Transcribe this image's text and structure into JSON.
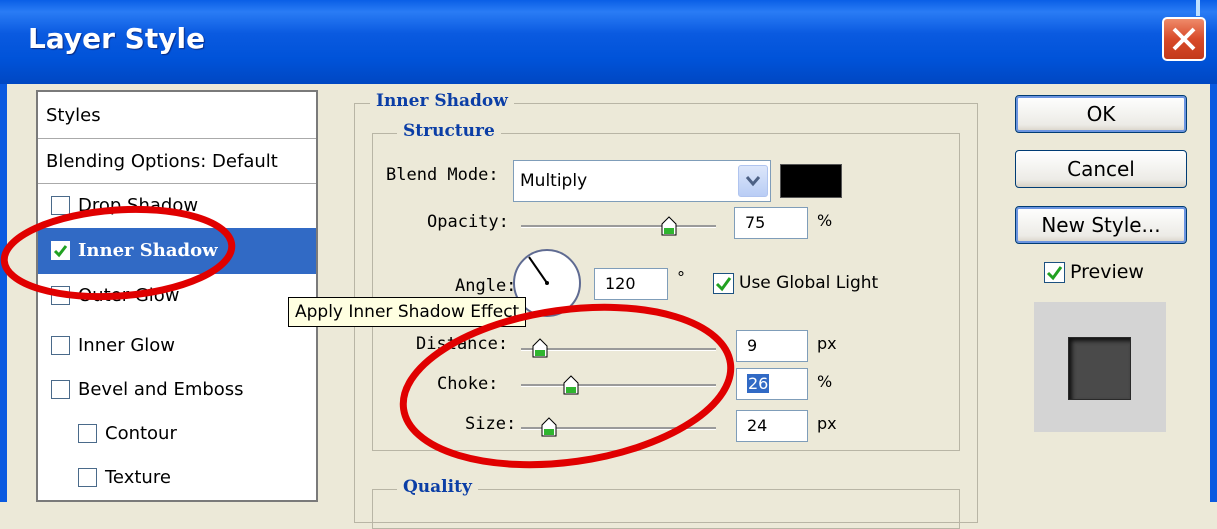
{
  "window": {
    "title": "Layer Style"
  },
  "styles_panel": {
    "header": "Styles",
    "blending": "Blending Options: Default",
    "items": [
      {
        "label": "Drop Shadow",
        "checked": false,
        "selected": false,
        "indent": false
      },
      {
        "label": "Inner Shadow",
        "checked": true,
        "selected": true,
        "indent": false
      },
      {
        "label": "Outer Glow",
        "checked": false,
        "selected": false,
        "indent": false
      },
      {
        "label": "Inner Glow",
        "checked": false,
        "selected": false,
        "indent": false
      },
      {
        "label": "Bevel and Emboss",
        "checked": false,
        "selected": false,
        "indent": false
      },
      {
        "label": "Contour",
        "checked": false,
        "selected": false,
        "indent": true
      },
      {
        "label": "Texture",
        "checked": false,
        "selected": false,
        "indent": true
      }
    ]
  },
  "inner_shadow": {
    "group_title": "Inner Shadow",
    "structure_title": "Structure",
    "quality_title": "Quality",
    "blend_mode": {
      "label": "Blend Mode:",
      "value": "Multiply",
      "color": "#000000"
    },
    "opacity": {
      "label": "Opacity:",
      "value": "75",
      "unit": "%",
      "slider_fraction": 0.75
    },
    "angle": {
      "label": "Angle:",
      "value": "120",
      "unit": "°",
      "use_global_light": "Use Global Light",
      "global_checked": true
    },
    "distance": {
      "label": "Distance:",
      "value": "9",
      "unit": "px",
      "slider_fraction": 0.04
    },
    "choke": {
      "label": "Choke:",
      "value": "26",
      "unit": "%",
      "slider_fraction": 0.26
    },
    "size": {
      "label": "Size:",
      "value": "24",
      "unit": "px",
      "slider_fraction": 0.1
    }
  },
  "buttons": {
    "ok": "OK",
    "cancel": "Cancel",
    "new_style": "New Style..."
  },
  "preview": {
    "label": "Preview",
    "checked": true
  },
  "tooltip": "Apply Inner Shadow Effect",
  "colors": {
    "title_bar": "#0a5ae0",
    "selection": "#316ac5",
    "annotation": "#e00000",
    "group_title": "#0b3ea6"
  }
}
